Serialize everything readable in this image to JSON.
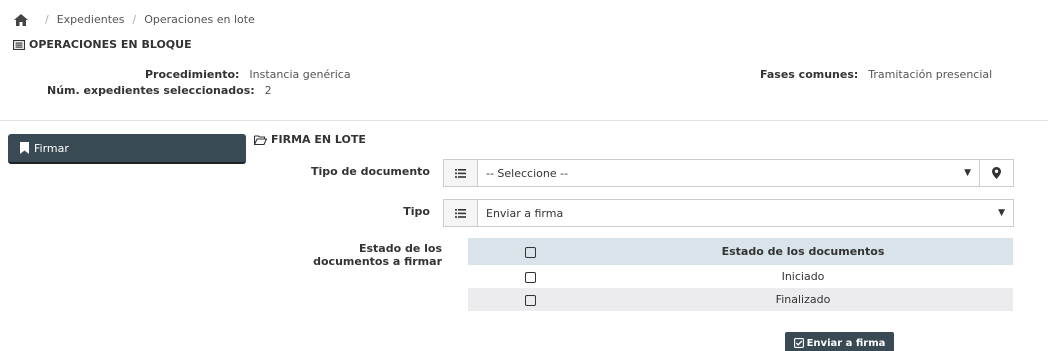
{
  "breadcrumb": {
    "home_icon": "home-icon",
    "items": [
      "Expedientes",
      "Operaciones en lote"
    ],
    "separator": "/"
  },
  "page_title": "OPERACIONES EN BLOQUE",
  "info": {
    "procedimiento_label": "Procedimiento:",
    "procedimiento_value": "Instancia genérica",
    "num_label": "Núm. expedientes seleccionados:",
    "num_value": "2",
    "fases_label": "Fases comunes:",
    "fases_value": "Tramitación presencial"
  },
  "sidebar": {
    "button_label": "Firmar",
    "button_icon": "bookmark-icon"
  },
  "section": {
    "title": "FIRMA EN LOTE",
    "icon": "folder-open-icon"
  },
  "form": {
    "tipo_documento_label": "Tipo de documento",
    "tipo_documento_value": "-- Seleccione --",
    "tipo_label": "Tipo",
    "tipo_value": "Enviar a firma",
    "estado_label": "Estado de los documentos a firmar"
  },
  "table": {
    "header": "Estado de los documentos",
    "rows": [
      "Iniciado",
      "Finalizado"
    ]
  },
  "submit": {
    "label": "Enviar a firma",
    "icon": "check-square-icon"
  },
  "colors": {
    "dark_button": "#3a4a55",
    "table_header": "#d8e3ea",
    "row_alt": "#ececef"
  }
}
